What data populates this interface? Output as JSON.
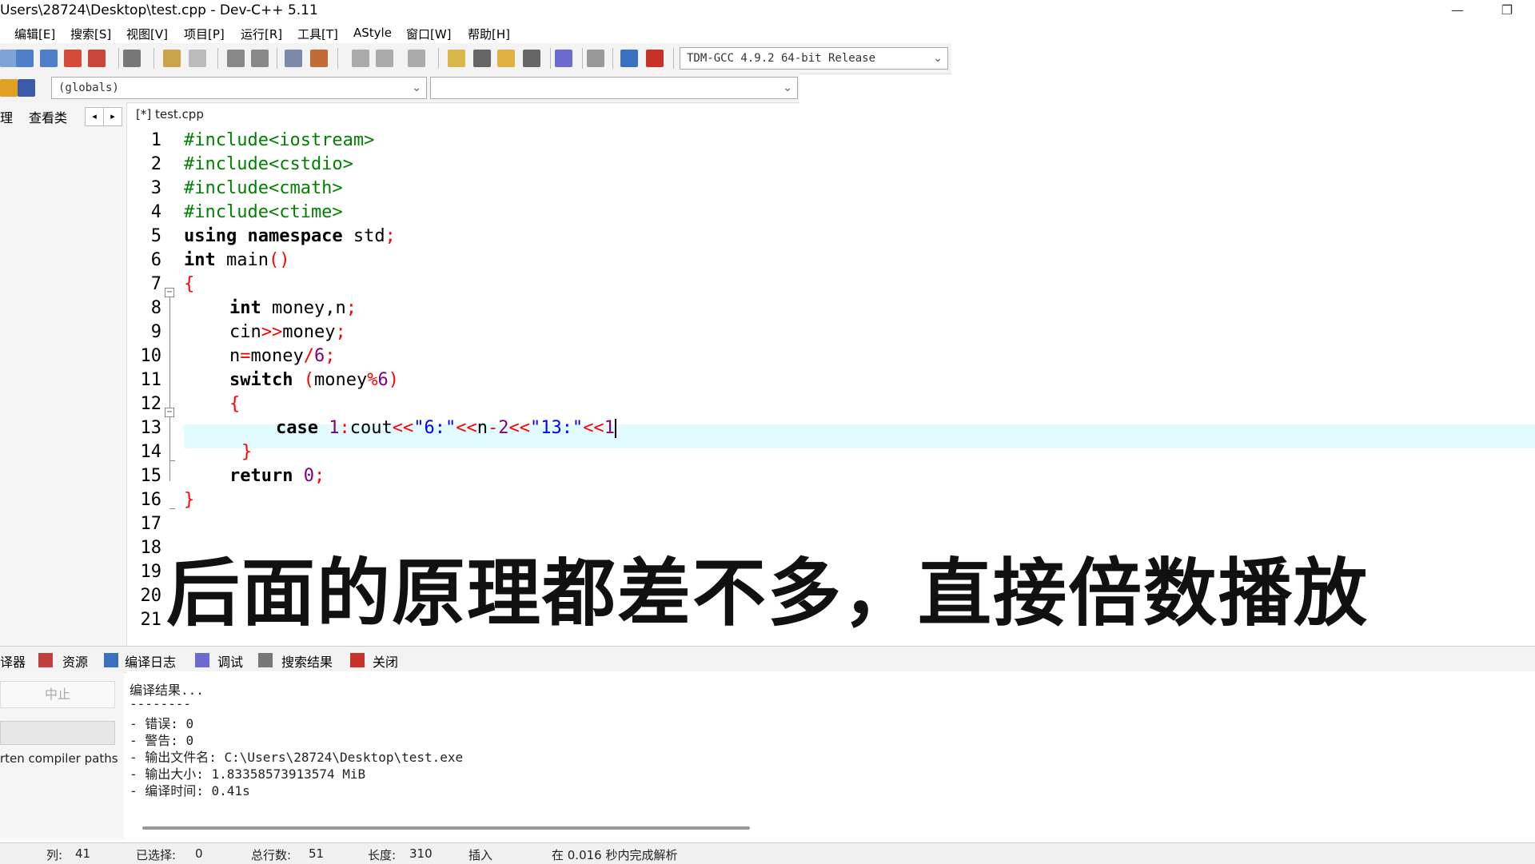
{
  "window": {
    "title": "Users\\28724\\Desktop\\test.cpp - Dev-C++ 5.11",
    "minimize_glyph": "—",
    "restore_glyph": "❐"
  },
  "menu": [
    "编辑[E]",
    "搜索[S]",
    "视图[V]",
    "项目[P]",
    "运行[R]",
    "工具[T]",
    "AStyle",
    "窗口[W]",
    "帮助[H]"
  ],
  "toolbar": {
    "compiler": "TDM-GCC 4.9.2 64-bit Release",
    "scope": "(globals)",
    "function": ""
  },
  "left_panel": {
    "tabs": [
      "理",
      "查看类"
    ],
    "nav_prev": "◂",
    "nav_next": "▸"
  },
  "editor": {
    "file_tab": "[*] test.cpp",
    "line_numbers": [
      "1",
      "2",
      "3",
      "4",
      "5",
      "6",
      "7",
      "8",
      "9",
      "10",
      "11",
      "12",
      "13",
      "14",
      "15",
      "16",
      "17",
      "18",
      "19",
      "20",
      "21"
    ],
    "code": {
      "l1": "#include<iostream>",
      "l2": "#include<cstdio>",
      "l3": "#include<cmath>",
      "l4": "#include<ctime>",
      "l5_kw": "using namespace",
      "l5_id": " std",
      "l5_sym": ";",
      "l6_kw": "int",
      "l6_id": " main",
      "l6_sym": "()",
      "l7": "{",
      "l8_kw": "int",
      "l8_id": " money,n",
      "l8_sym": ";",
      "l9_id1": "cin",
      "l9_sym1": ">>",
      "l9_id2": "money",
      "l9_sym2": ";",
      "l10_id1": "n",
      "l10_sym1": "=",
      "l10_id2": "money",
      "l10_sym2": "/",
      "l10_num": "6",
      "l10_sym3": ";",
      "l11_kw": "switch",
      "l11_sym1": " (",
      "l11_id": "money",
      "l11_sym2": "%",
      "l11_num": "6",
      "l11_sym3": ")",
      "l12": "{",
      "l13_kw": "case",
      "l13_num1": " 1",
      "l13_sym1": ":",
      "l13_id1": "cout",
      "l13_sym2": "<<",
      "l13_str1": "\"6:\"",
      "l13_sym3": "<<",
      "l13_id2": "n",
      "l13_sym4": "-",
      "l13_num2": "2",
      "l13_sym5": "<<",
      "l13_str2": "\"13:\"",
      "l13_sym6": "<<",
      "l13_num3": "1",
      "l14": "}",
      "l15_kw": "return",
      "l15_num": " 0",
      "l15_sym": ";",
      "l16": "}"
    }
  },
  "subtitle": "后面的原理都差不多，直接倍数播放",
  "bottom_tabs": [
    "译器",
    "资源",
    "编译日志",
    "调试",
    "搜索结果",
    "关闭"
  ],
  "bottom_left": {
    "stop": "中止",
    "shorten": "rten compiler paths"
  },
  "output": [
    "编译结果...",
    "--------",
    "- 错误: 0",
    "- 警告: 0",
    "- 输出文件名: C:\\Users\\28724\\Desktop\\test.exe",
    "- 输出大小: 1.83358573913574 MiB",
    "- 编译时间: 0.41s"
  ],
  "status": {
    "col_label": "列:",
    "col": "41",
    "sel_label": "已选择:",
    "sel": "0",
    "lines_label": "总行数:",
    "lines": "51",
    "len_label": "长度:",
    "len": "310",
    "mode": "插入",
    "parse": "在 0.016 秒内完成解析"
  },
  "colors": {
    "keyword": "#000000",
    "preprocessor": "#008000",
    "symbol": "#ff0000",
    "number": "#800080",
    "string": "#0000ff",
    "current_line": "#e0fafd"
  }
}
